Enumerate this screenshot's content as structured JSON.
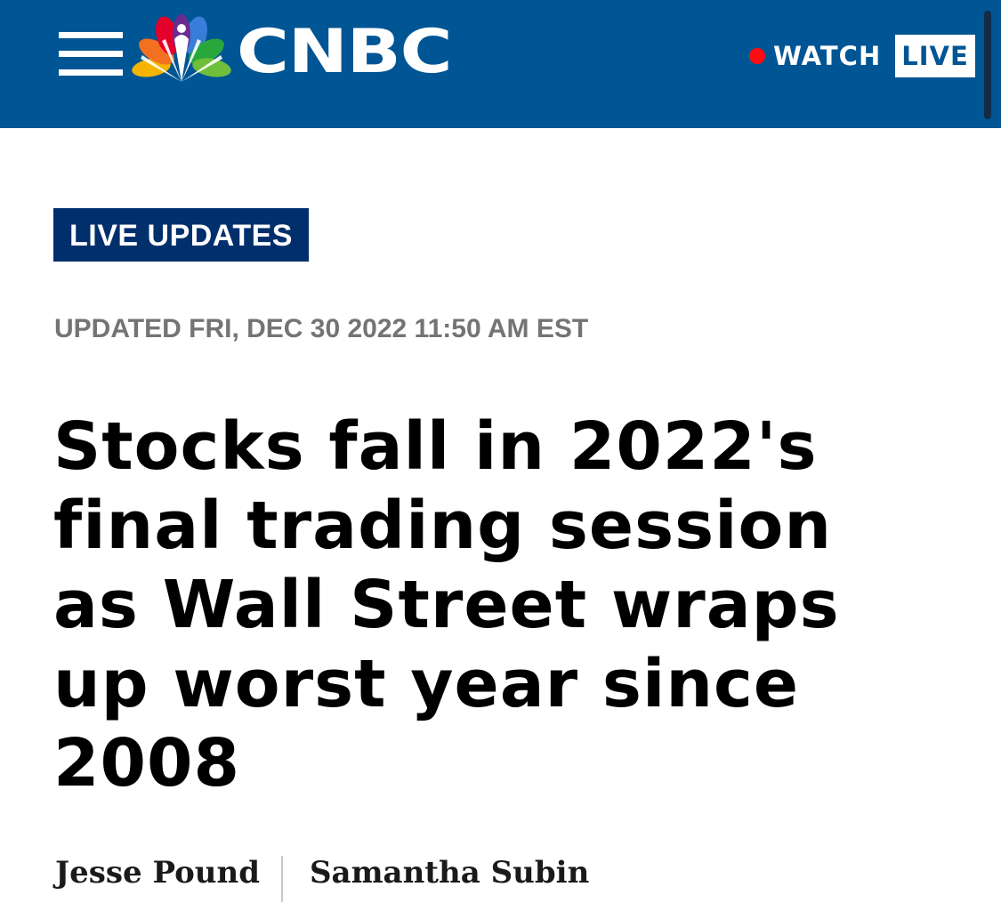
{
  "header": {
    "brand_name": "CNBC",
    "brand_color": "#005594",
    "menu_icon": "hamburger-menu-icon",
    "logo_icon": "nbc-peacock-icon",
    "watch": {
      "label": "WATCH",
      "live_label": "LIVE",
      "live_dot_color": "#ff0d12"
    }
  },
  "article": {
    "badge": "LIVE UPDATES",
    "badge_color": "#002f6c",
    "updated": "UPDATED FRI, DEC 30 2022 11:50 AM EST",
    "headline": "Stocks fall in 2022's final trading session as Wall Street wraps up worst year since 2008",
    "authors": [
      {
        "name": "Jesse Pound"
      },
      {
        "name": "Samantha Subin"
      }
    ]
  }
}
